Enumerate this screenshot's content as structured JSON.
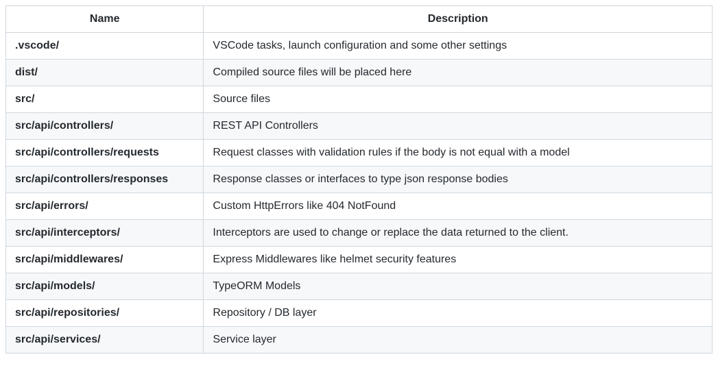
{
  "table": {
    "headers": {
      "name": "Name",
      "description": "Description"
    },
    "rows": [
      {
        "name": ".vscode/",
        "description": "VSCode tasks, launch configuration and some other settings"
      },
      {
        "name": "dist/",
        "description": "Compiled source files will be placed here"
      },
      {
        "name": "src/",
        "description": "Source files"
      },
      {
        "name": "src/api/controllers/",
        "description": "REST API Controllers"
      },
      {
        "name": "src/api/controllers/requests",
        "description": "Request classes with validation rules if the body is not equal with a model"
      },
      {
        "name": "src/api/controllers/responses",
        "description": "Response classes or interfaces to type json response bodies"
      },
      {
        "name": "src/api/errors/",
        "description": "Custom HttpErrors like 404 NotFound"
      },
      {
        "name": "src/api/interceptors/",
        "description": "Interceptors are used to change or replace the data returned to the client."
      },
      {
        "name": "src/api/middlewares/",
        "description": "Express Middlewares like helmet security features"
      },
      {
        "name": "src/api/models/",
        "description": "TypeORM Models"
      },
      {
        "name": "src/api/repositories/",
        "description": "Repository / DB layer"
      },
      {
        "name": "src/api/services/",
        "description": "Service layer"
      }
    ]
  }
}
